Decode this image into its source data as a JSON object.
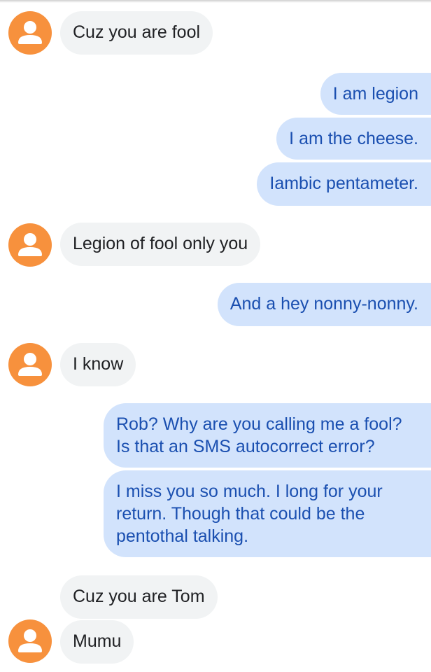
{
  "colors": {
    "avatar": "#f7913d",
    "incoming_bubble": "#f1f3f4",
    "incoming_text": "#202124",
    "outgoing_bubble": "#d2e3fc",
    "outgoing_text": "#1a4fb0"
  },
  "avatar_icon": "person-icon",
  "messages": [
    {
      "direction": "incoming",
      "text": "Cuz you are fool"
    },
    {
      "direction": "outgoing",
      "text": "I am legion"
    },
    {
      "direction": "outgoing",
      "text": "I am the cheese."
    },
    {
      "direction": "outgoing",
      "text": "Iambic pentameter."
    },
    {
      "direction": "incoming",
      "text": "Legion of fool only you"
    },
    {
      "direction": "outgoing",
      "text": "And a hey nonny-nonny."
    },
    {
      "direction": "incoming",
      "text": "I know"
    },
    {
      "direction": "outgoing",
      "text": "Rob?  Why are you calling me a fool?  Is that an SMS autocorrect error?"
    },
    {
      "direction": "outgoing",
      "text": "I miss you so much.  I long for your return. Though that could be the pentothal talking."
    },
    {
      "direction": "incoming",
      "text": "Cuz you are Tom"
    },
    {
      "direction": "incoming",
      "text": "Mumu"
    }
  ]
}
